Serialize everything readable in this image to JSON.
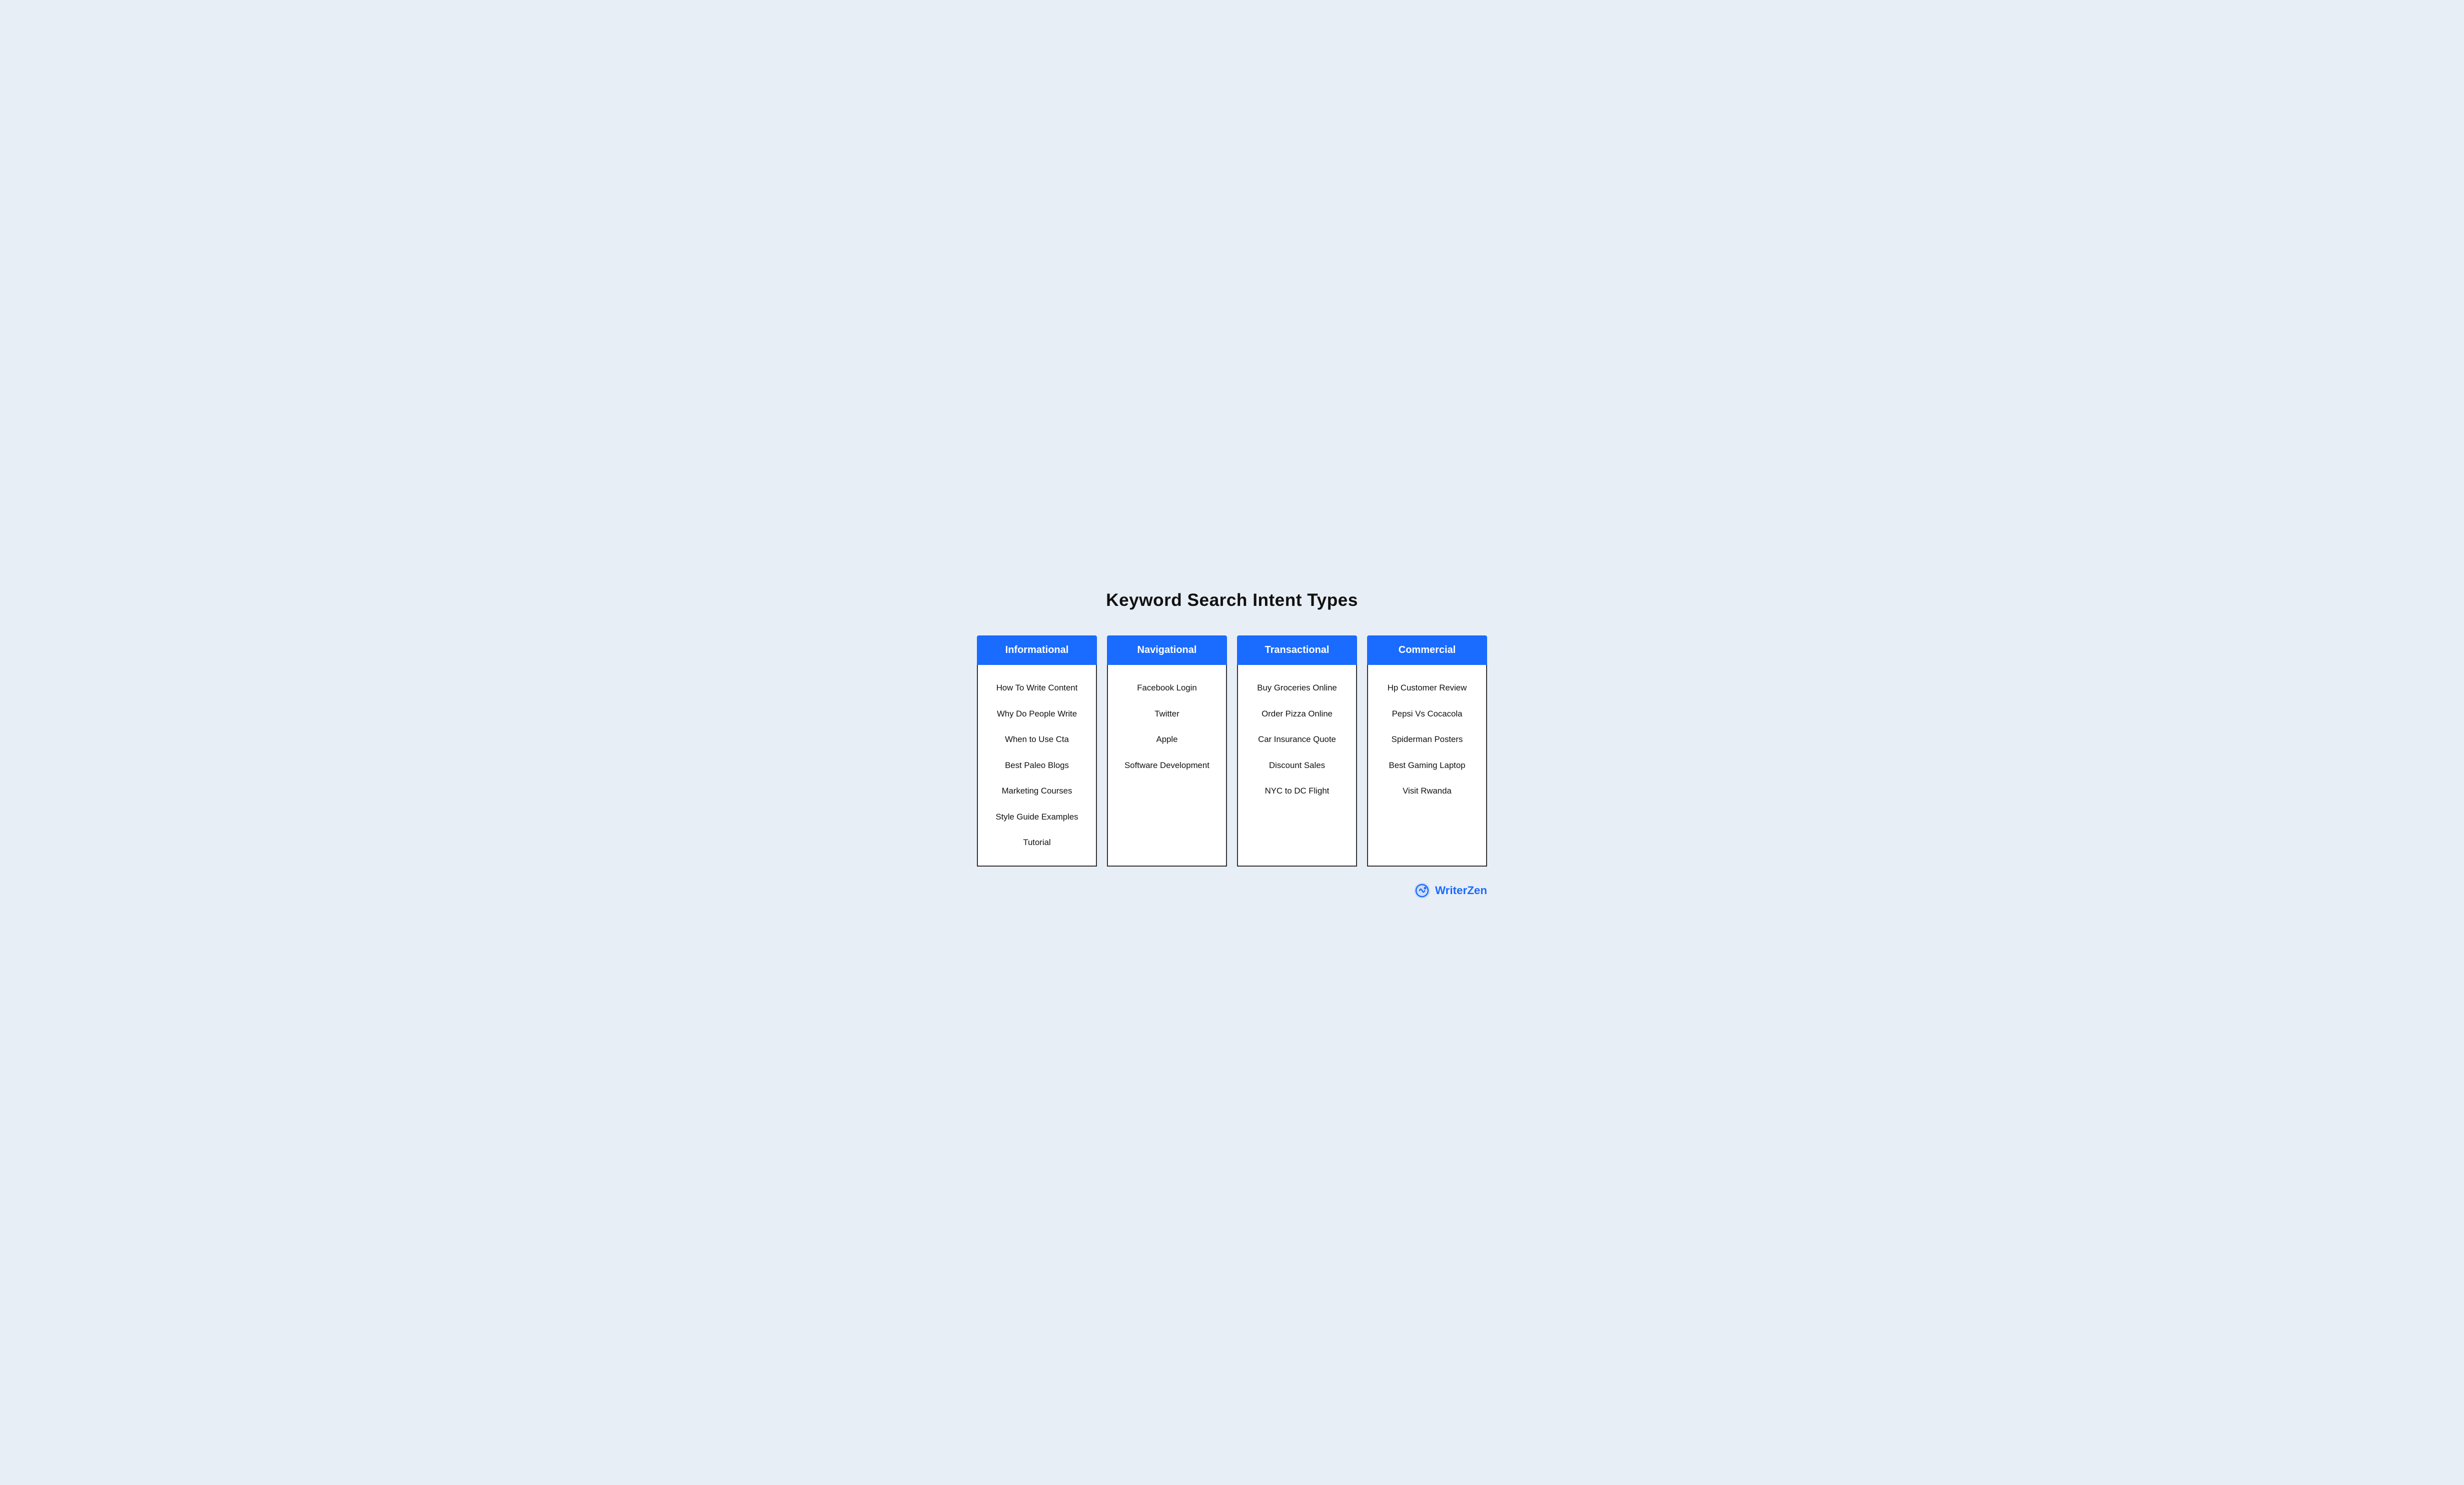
{
  "page": {
    "title": "Keyword Search Intent Types",
    "background": "#e8eef5"
  },
  "columns": [
    {
      "id": "informational",
      "header": "Informational",
      "items": [
        "How To Write Content",
        "Why Do People Write",
        "When to Use Cta",
        "Best Paleo Blogs",
        "Marketing Courses",
        "Style Guide Examples",
        "Tutorial"
      ]
    },
    {
      "id": "navigational",
      "header": "Navigational",
      "items": [
        "Facebook Login",
        "Twitter",
        "Apple",
        "Software Development"
      ]
    },
    {
      "id": "transactional",
      "header": "Transactional",
      "items": [
        "Buy Groceries Online",
        "Order Pizza Online",
        "Car Insurance Quote",
        "Discount Sales",
        "NYC to DC Flight"
      ]
    },
    {
      "id": "commercial",
      "header": "Commercial",
      "items": [
        "Hp Customer Review",
        "Pepsi Vs Cocacola",
        "Spiderman Posters",
        "Best Gaming Laptop",
        "Visit Rwanda"
      ]
    }
  ],
  "footer": {
    "logo_text": "WriterZen",
    "logo_blue_part": "Writer",
    "logo_black_part": "Zen"
  }
}
